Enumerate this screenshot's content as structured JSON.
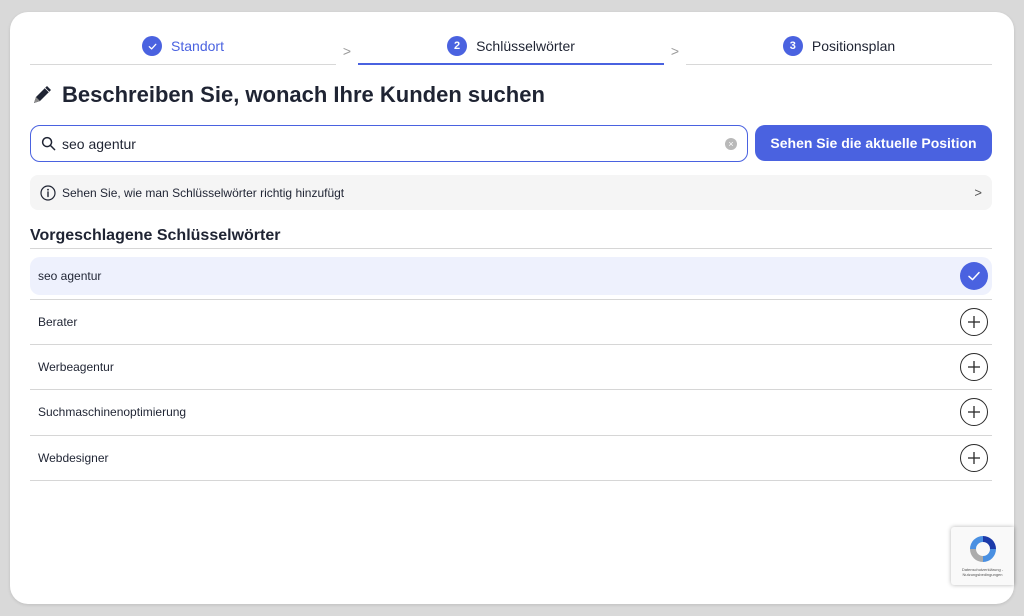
{
  "stepper": {
    "steps": [
      {
        "number": "",
        "label": "Standort",
        "state": "done"
      },
      {
        "number": "2",
        "label": "Schlüsselwörter",
        "state": "active"
      },
      {
        "number": "3",
        "label": "Positionsplan",
        "state": "pending"
      }
    ],
    "separator": ">"
  },
  "header": {
    "title": "Beschreiben Sie, wonach Ihre Kunden suchen"
  },
  "search": {
    "value": "seo agentur",
    "button_label": "Sehen Sie die aktuelle Position"
  },
  "info": {
    "text": "Sehen Sie, wie man Schlüsselwörter richtig hinzufügt",
    "chevron": ">"
  },
  "suggestions": {
    "title": "Vorgeschlagene Schlüsselwörter",
    "items": [
      {
        "label": "seo agentur",
        "selected": true
      },
      {
        "label": "Berater",
        "selected": false
      },
      {
        "label": "Werbeagentur",
        "selected": false
      },
      {
        "label": "Suchmaschinenoptimierung",
        "selected": false
      },
      {
        "label": "Webdesigner",
        "selected": false
      }
    ]
  },
  "recaptcha": {
    "text": "Datenschutzerklärung - Nutzungsbedingungen"
  },
  "colors": {
    "accent": "#4a62e0",
    "selected_row": "#eef1fd",
    "info_bg": "#f5f5f5"
  }
}
